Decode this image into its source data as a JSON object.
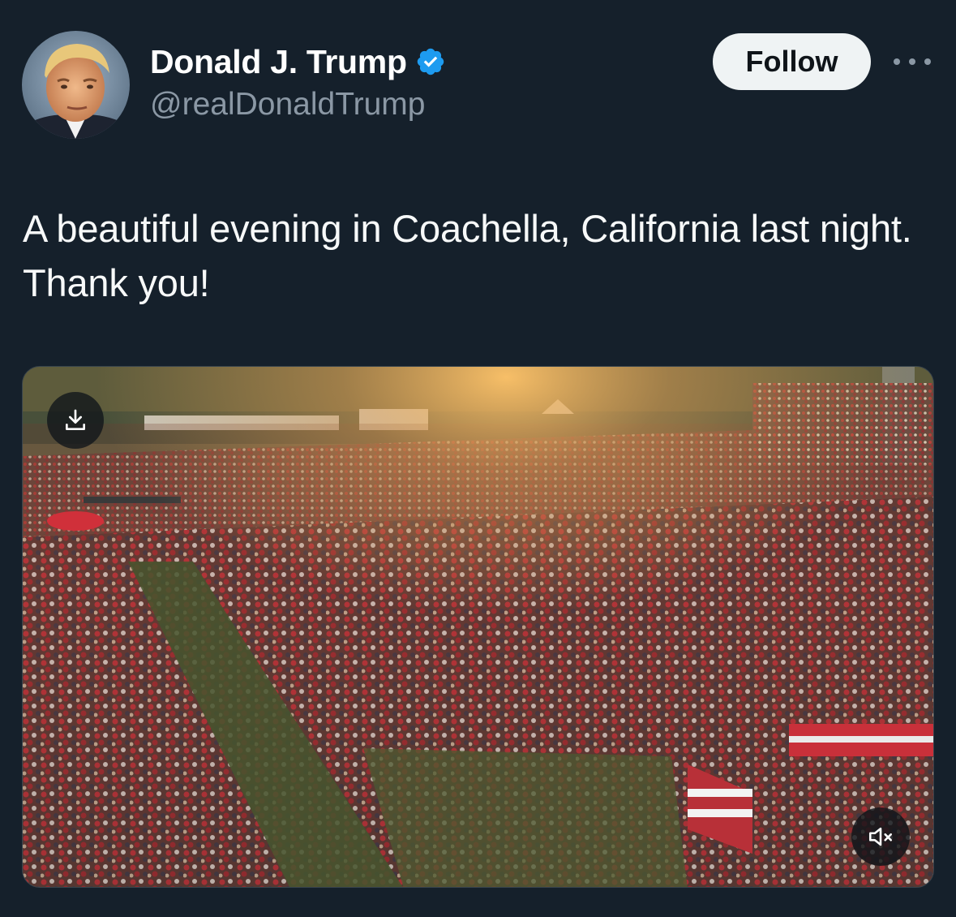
{
  "author": {
    "display_name": "Donald J. Trump",
    "handle": "@realDonaldTrump",
    "verified": true,
    "avatar_icon": "profile-photo"
  },
  "actions": {
    "follow_label": "Follow",
    "more_icon": "more-horizontal-icon"
  },
  "tweet": {
    "text": "A beautiful evening in Coachella, California last night. Thank you!"
  },
  "media": {
    "type": "video",
    "download_icon": "download-icon",
    "mute_icon": "volume-muted-icon"
  },
  "colors": {
    "background": "#15202b",
    "text_primary": "#f7f9f9",
    "text_secondary": "#8b98a5",
    "verified_blue": "#1d9bf0",
    "follow_bg": "#eff3f4"
  }
}
